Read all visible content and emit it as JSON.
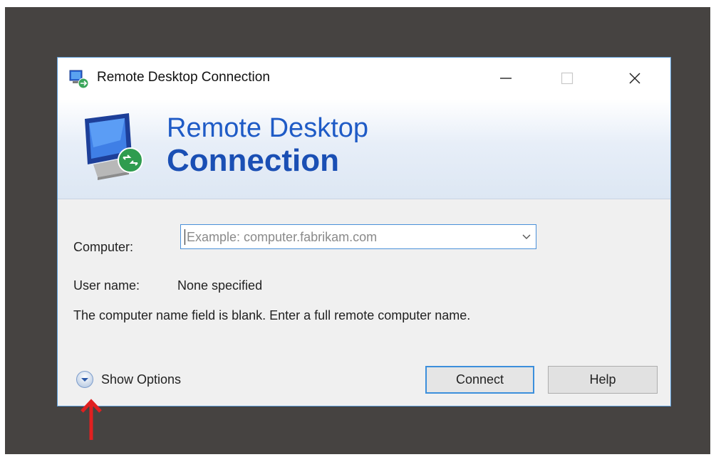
{
  "window": {
    "title": "Remote Desktop Connection",
    "app_icon": "remote-desktop-icon",
    "controls": {
      "minimize": "minimize-icon",
      "maximize": "maximize-icon",
      "close": "close-icon"
    }
  },
  "banner": {
    "line1": "Remote Desktop",
    "line2": "Connection",
    "icon": "monitor-connection-icon"
  },
  "form": {
    "computer_label": "Computer:",
    "computer_value": "",
    "computer_placeholder": "Example: computer.fabrikam.com",
    "username_label": "User name:",
    "username_value": "None specified",
    "info_message": "The computer name field is blank. Enter a full remote computer name."
  },
  "footer": {
    "show_options_label": "Show Options",
    "connect_label": "Connect",
    "help_label": "Help"
  },
  "annotation": {
    "icon": "red-up-arrow-icon"
  },
  "colors": {
    "backdrop": "#464341",
    "dialog_bg": "#f0f0f0",
    "accent_blue": "#1f5bc6",
    "focus_border": "#3c8fdc",
    "arrow_red": "#e02020"
  }
}
